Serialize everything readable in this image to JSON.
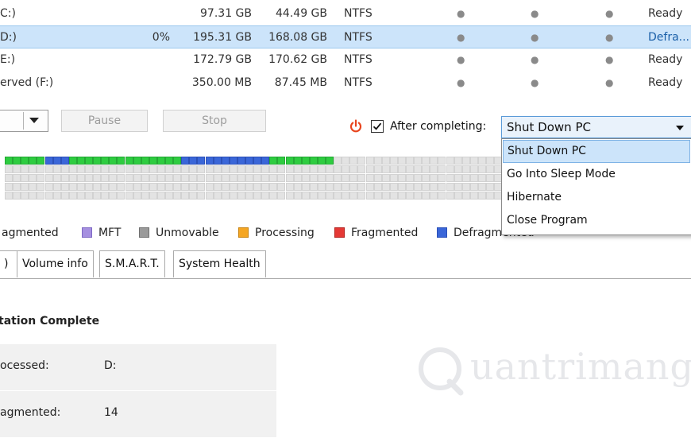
{
  "drives": [
    {
      "name": "C:)",
      "fragmented": "",
      "capacity": "97.31 GB",
      "free": "44.49 GB",
      "fs": "NTFS",
      "status": "Ready",
      "selected": false
    },
    {
      "name": "D:)",
      "fragmented": "0%",
      "capacity": "195.31 GB",
      "free": "168.08 GB",
      "fs": "NTFS",
      "status": "Defra...",
      "selected": true
    },
    {
      "name": "E:)",
      "fragmented": "",
      "capacity": "172.79 GB",
      "free": "170.62 GB",
      "fs": "NTFS",
      "status": "Ready",
      "selected": false
    },
    {
      "name": "erved (F:)",
      "fragmented": "",
      "capacity": "350.00 MB",
      "free": "87.45 MB",
      "fs": "NTFS",
      "status": "Ready",
      "selected": false
    }
  ],
  "dot_glyph": "●",
  "controls": {
    "pause_label": "Pause",
    "stop_label": "Stop",
    "after_completing_label": "After completing:",
    "after_completing_checked": true,
    "after_completing_value": "Shut Down PC",
    "options": [
      "Shut Down PC",
      "Go Into Sleep Mode",
      "Hibernate",
      "Close Program"
    ],
    "highlighted_option": "Shut Down PC"
  },
  "legend": [
    {
      "label": "agmented",
      "color": ""
    },
    {
      "label": "MFT",
      "color": "#a58fe0"
    },
    {
      "label": "Unmovable",
      "color": "#9a9a9a"
    },
    {
      "label": "Processing",
      "color": "#f5a623"
    },
    {
      "label": "Fragmented",
      "color": "#e53935"
    },
    {
      "label": "Defragmented",
      "color": "#3a66d8"
    }
  ],
  "tabs": [
    ")",
    "Volume info",
    "S.M.A.R.T.",
    "System Health"
  ],
  "report": {
    "title": "tation Complete",
    "rows": [
      {
        "label": "ocessed:",
        "value": "D:"
      },
      {
        "label": "agmented:",
        "value": "14"
      }
    ]
  },
  "watermark": "uantrimang",
  "colors": {
    "selection": "#cce4fa",
    "power_icon": "#e8451e",
    "cluster_defragmented": "#2ecc40",
    "cluster_blue": "#3a66d8",
    "cluster_free": "#e3e3e3"
  }
}
